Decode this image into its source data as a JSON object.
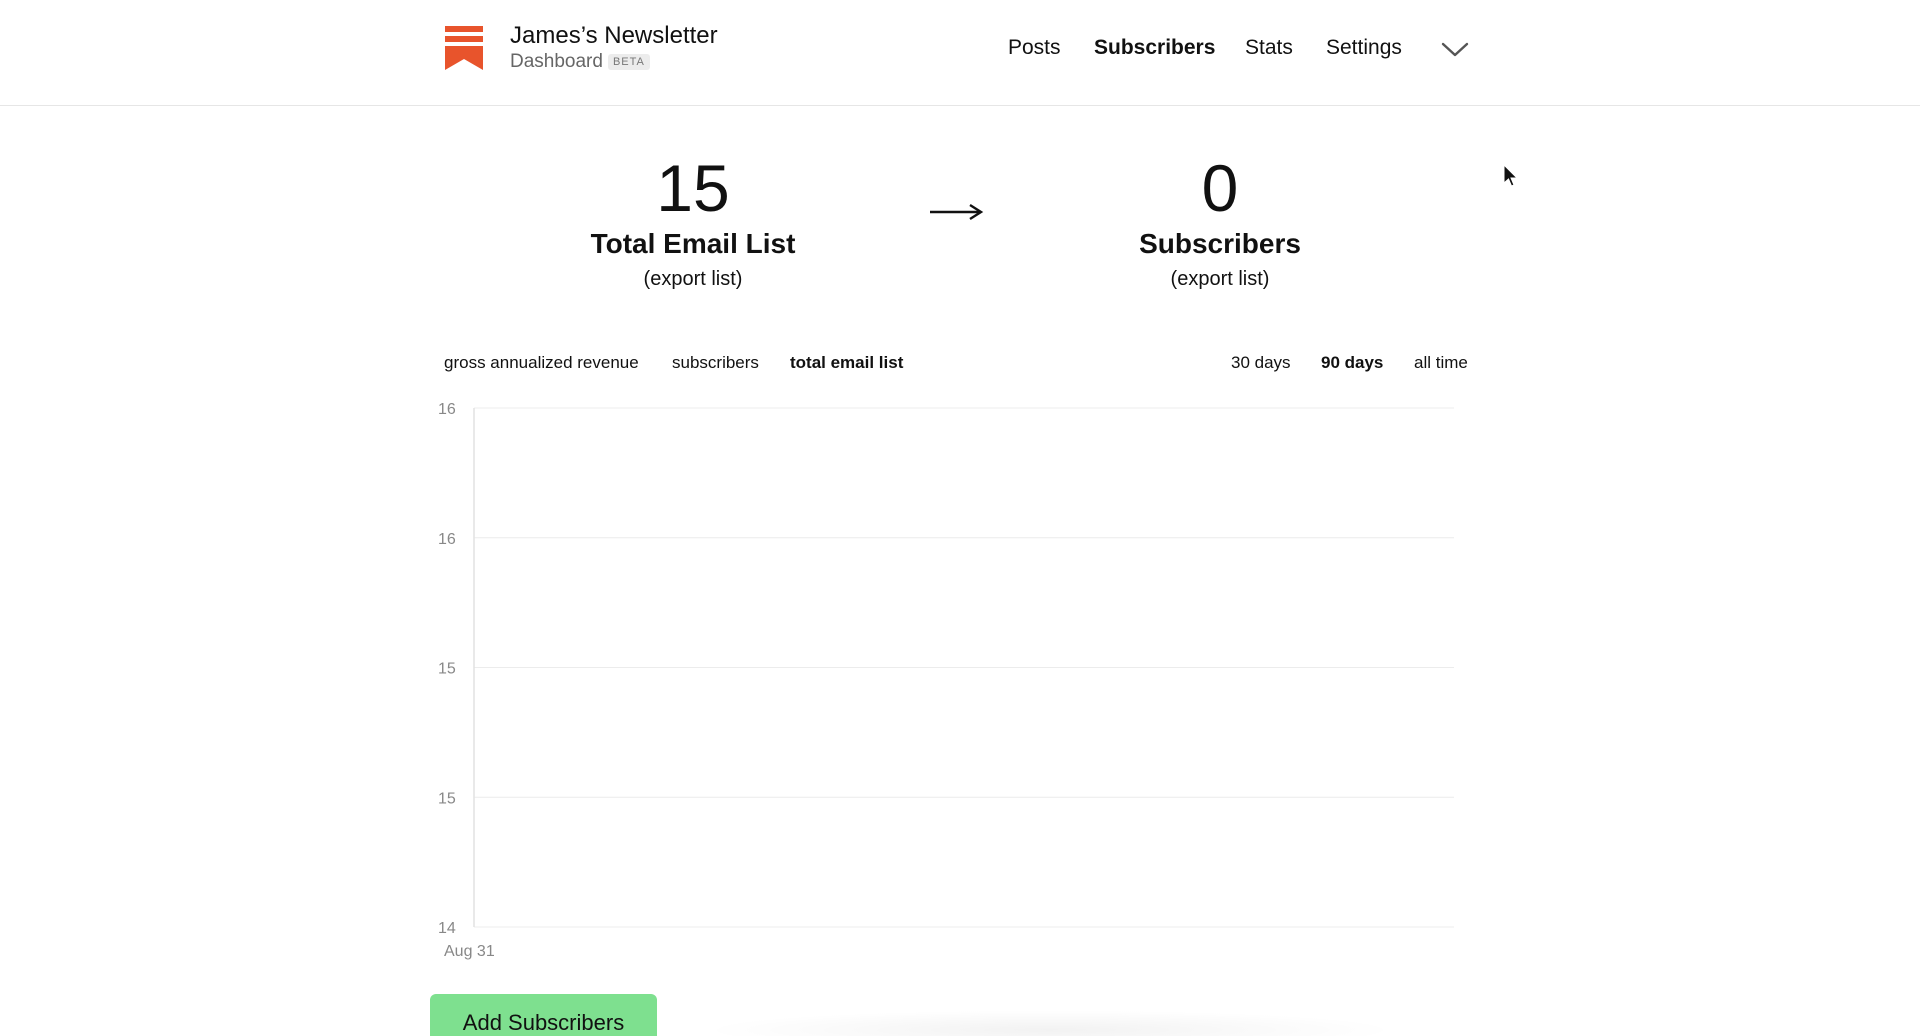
{
  "header": {
    "title": "James’s Newsletter",
    "subtitle": "Dashboard",
    "badge": "BETA",
    "logo_color": "#e8542c",
    "nav": {
      "posts": "Posts",
      "subscribers": "Subscribers",
      "stats": "Stats",
      "settings": "Settings"
    },
    "active_nav": "Subscribers",
    "menu_icon": "chevron-down-icon"
  },
  "stats": {
    "left": {
      "value": "15",
      "label": "Total Email List",
      "export": "(export list)"
    },
    "arrow_icon": "arrow-right-icon",
    "right": {
      "value": "0",
      "label": "Subscribers",
      "export": "(export list)"
    }
  },
  "metric_tabs": [
    "gross annualized revenue",
    "subscribers",
    "total email list"
  ],
  "active_metric": "total email list",
  "range_tabs": [
    "30 days",
    "90 days",
    "all time"
  ],
  "active_range": "90 days",
  "chart_data": {
    "type": "line",
    "y_tick_labels": [
      "16",
      "16",
      "15",
      "15",
      "14"
    ],
    "x_tick_labels": [
      "Aug 31"
    ],
    "series": [],
    "grid": true
  },
  "actions": {
    "add_subscribers": "Add Subscribers",
    "add_button_color": "#7ee08f"
  }
}
